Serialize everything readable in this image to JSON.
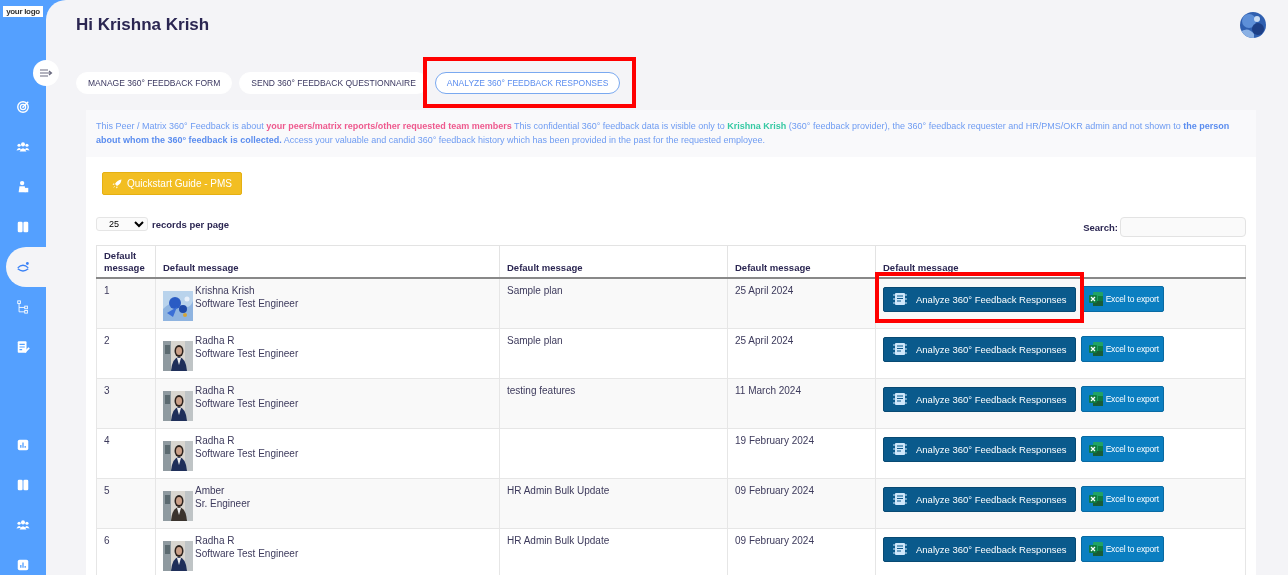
{
  "logo": "your logo",
  "sidebar": {
    "items": [
      {
        "kind": "target",
        "selected": false
      },
      {
        "kind": "team",
        "selected": false
      },
      {
        "kind": "person",
        "selected": false
      },
      {
        "kind": "book",
        "selected": false
      },
      {
        "kind": "cycle",
        "selected": true
      },
      {
        "kind": "tree",
        "selected": false
      },
      {
        "kind": "form",
        "selected": false
      },
      {
        "kind": "chart",
        "selected": false
      },
      {
        "kind": "book",
        "selected": false
      },
      {
        "kind": "team",
        "selected": false
      },
      {
        "kind": "chart",
        "selected": false
      }
    ]
  },
  "greeting": "Hi Krishna Krish",
  "tabs": [
    {
      "label": "MANAGE 360° FEEDBACK FORM",
      "selected": false,
      "highlighted": false
    },
    {
      "label": "SEND 360° FEEDBACK QUESTIONNAIRE",
      "selected": false,
      "highlighted": false
    },
    {
      "label": "ANALYZE 360° FEEDBACK RESPONSES",
      "selected": true,
      "highlighted": true
    }
  ],
  "intro": {
    "segments": [
      {
        "kind": "plain",
        "text": "This Peer / Matrix 360° Feedback is about "
      },
      {
        "kind": "highlight",
        "text": "your peers/matrix reports/other requested team members"
      },
      {
        "kind": "plain",
        "text": " This confidential 360° feedback data is visible only to "
      },
      {
        "kind": "name",
        "text": "Krishna Krish"
      },
      {
        "kind": "plain",
        "text": " (360° feedback provider), the 360° feedback requester and HR/PMS/OKR admin and not shown to "
      },
      {
        "kind": "emphasis",
        "text": "the person about whom the 360° feedback is collected."
      },
      {
        "kind": "plain",
        "text": " Access your valuable and candid 360° feedback history which has been provided in the past for the requested employee."
      }
    ]
  },
  "guide_button": "Quickstart Guide - PMS",
  "page_size": {
    "value": "25",
    "label": "records per page"
  },
  "search": {
    "label": "Search:"
  },
  "table": {
    "columns": [
      "Default message",
      "Default message",
      "Default message",
      "Default message",
      "Default message"
    ],
    "rows": [
      {
        "number": "1",
        "name": "Krishna Krish",
        "title": "Software Test Engineer",
        "plan": "Sample plan",
        "date": "25 April 2024",
        "analyze": "Analyze 360° Feedback Responses",
        "export": "Excel to export",
        "highlighted": true
      },
      {
        "number": "2",
        "name": "Radha R",
        "title": "Software Test Engineer",
        "plan": "Sample plan",
        "date": "25 April 2024",
        "analyze": "Analyze 360° Feedback Responses",
        "export": "Excel to export",
        "highlighted": false
      },
      {
        "number": "3",
        "name": "Radha R",
        "title": "Software Test Engineer",
        "plan": "testing features",
        "date": "11 March 2024",
        "analyze": "Analyze 360° Feedback Responses",
        "export": "Excel to export",
        "highlighted": false
      },
      {
        "number": "4",
        "name": "Radha R",
        "title": "Software Test Engineer",
        "plan": "",
        "date": "19 February 2024",
        "analyze": "Analyze 360° Feedback Responses",
        "export": "Excel to export",
        "highlighted": false
      },
      {
        "number": "5",
        "name": "Amber",
        "title": "Sr. Engineer",
        "plan": "HR Admin Bulk Update",
        "date": "09 February 2024",
        "analyze": "Analyze 360° Feedback Responses",
        "export": "Excel to export",
        "highlighted": false
      },
      {
        "number": "6",
        "name": "Radha R",
        "title": "Software Test Engineer",
        "plan": "HR Admin Bulk Update",
        "date": "09 February 2024",
        "analyze": "Analyze 360° Feedback Responses",
        "export": "Excel to export",
        "highlighted": false
      }
    ]
  }
}
